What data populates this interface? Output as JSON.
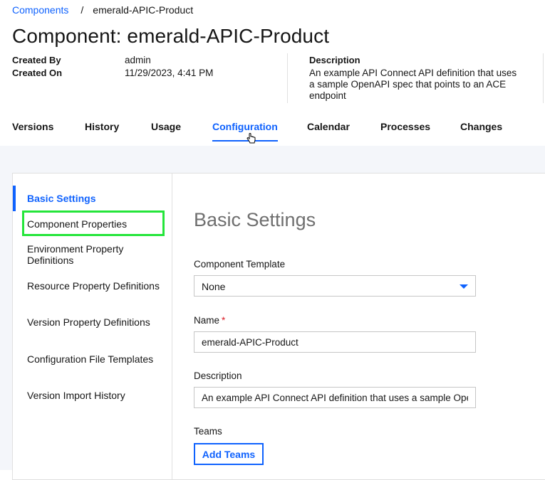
{
  "breadcrumb": {
    "parent": "Components",
    "separator": "/",
    "current": "emerald-APIC-Product"
  },
  "page_title": "Component: emerald-APIC-Product",
  "meta": {
    "created_by_label": "Created By",
    "created_by_value": "admin",
    "created_on_label": "Created On",
    "created_on_value": "11/29/2023, 4:41 PM",
    "description_label": "Description",
    "description_value": "An example API Connect API definition that uses a sample OpenAPI spec that points to an ACE endpoint"
  },
  "tabs": [
    {
      "label": "Versions",
      "active": false
    },
    {
      "label": "History",
      "active": false
    },
    {
      "label": "Usage",
      "active": false
    },
    {
      "label": "Configuration",
      "active": true
    },
    {
      "label": "Calendar",
      "active": false
    },
    {
      "label": "Processes",
      "active": false
    },
    {
      "label": "Changes",
      "active": false
    }
  ],
  "sidenav": {
    "items": [
      {
        "label": "Basic Settings",
        "active": true
      },
      {
        "label": "Component Properties",
        "active": false,
        "highlighted": true
      },
      {
        "label": "Environment Property Definitions",
        "active": false
      },
      {
        "label": "Resource Property Definitions",
        "active": false
      },
      {
        "label": "Version Property Definitions",
        "active": false
      },
      {
        "label": "Configuration File Templates",
        "active": false
      },
      {
        "label": "Version Import History",
        "active": false
      }
    ]
  },
  "form": {
    "section_title": "Basic Settings",
    "template_label": "Component Template",
    "template_value": "None",
    "name_label": "Name",
    "name_required_mark": "*",
    "name_value": "emerald-APIC-Product",
    "description_label": "Description",
    "description_value": "An example API Connect API definition that uses a sample OpenAPI spec that points to an ACE endpoint",
    "teams_label": "Teams",
    "add_teams_label": "Add Teams"
  },
  "colors": {
    "accent": "#0f62fe",
    "highlight_box": "#24e53a",
    "required": "#da1e28",
    "page_background": "#f4f6fa"
  },
  "icons": {
    "select_caret": "chevron-down-icon",
    "cursor": "hand-pointer-icon"
  }
}
